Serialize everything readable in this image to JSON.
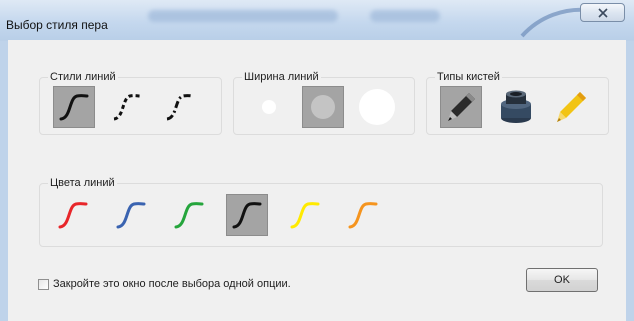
{
  "window": {
    "title": "Выбор стиля пера",
    "close_icon": "close-icon"
  },
  "line_styles": {
    "label": "Стили линий",
    "items": [
      {
        "name": "solid",
        "selected": true
      },
      {
        "name": "dashed",
        "selected": false
      },
      {
        "name": "dash-dot",
        "selected": false
      }
    ]
  },
  "line_widths": {
    "label": "Ширина линий",
    "items": [
      {
        "name": "thin",
        "selected": false
      },
      {
        "name": "medium",
        "selected": true
      },
      {
        "name": "thick",
        "selected": false
      }
    ]
  },
  "brush_types": {
    "label": "Типы кистей",
    "items": [
      {
        "name": "pen-brush-icon",
        "selected": true
      },
      {
        "name": "marker-brush-icon",
        "selected": false
      },
      {
        "name": "highlighter-brush-icon",
        "selected": false
      }
    ]
  },
  "line_colors": {
    "label": "Цвета линий",
    "items": [
      {
        "name": "red",
        "color": "#e8262a",
        "selected": false
      },
      {
        "name": "blue",
        "color": "#3a63b0",
        "selected": false
      },
      {
        "name": "green",
        "color": "#25a53c",
        "selected": false
      },
      {
        "name": "black",
        "color": "#111111",
        "selected": true
      },
      {
        "name": "yellow",
        "color": "#ffea00",
        "selected": false
      },
      {
        "name": "orange",
        "color": "#f5941e",
        "selected": false
      }
    ]
  },
  "footer": {
    "checkbox_label": "Закройте это окно после выбора одной опции.",
    "checkbox_checked": false,
    "ok_label": "OK"
  }
}
